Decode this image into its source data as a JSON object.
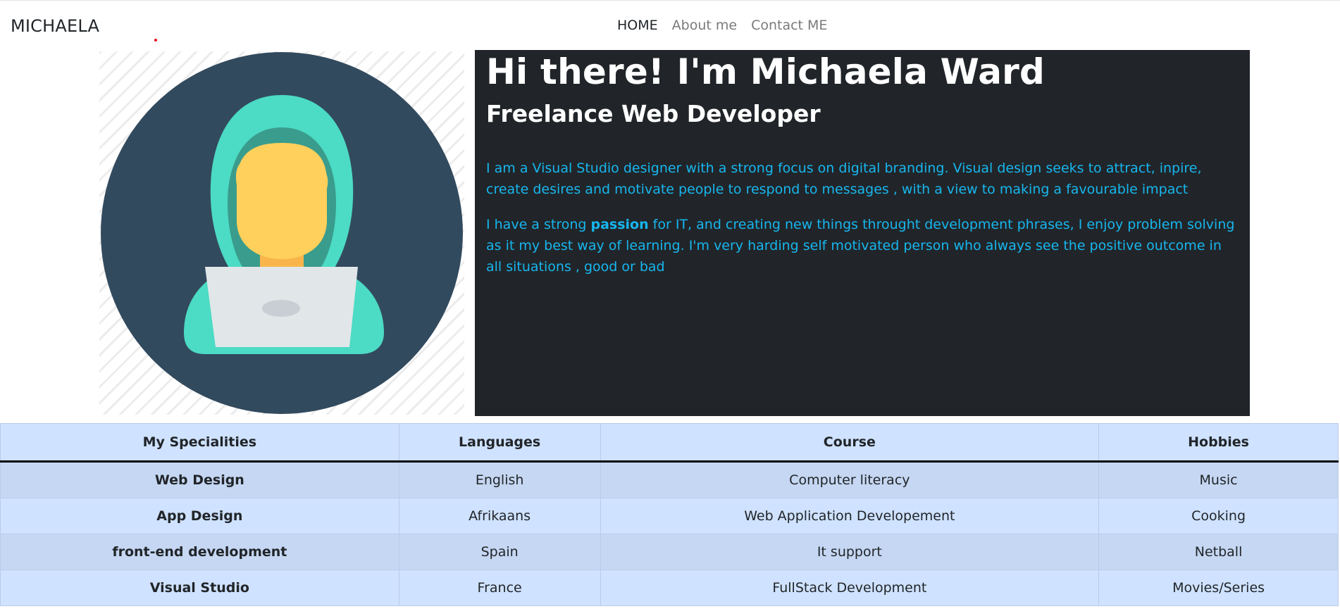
{
  "navbar": {
    "brand": "MICHAELA",
    "links": [
      {
        "label": "HOME",
        "active": true
      },
      {
        "label": "About me",
        "active": false
      },
      {
        "label": "Contact ME",
        "active": false
      }
    ]
  },
  "avatar": {
    "icon": "hooded-developer-with-laptop",
    "colors": {
      "circle": "#324a5e",
      "hood": "#4cdbc4",
      "hood_shadow": "#3a9c8c",
      "face": "#ffd05b",
      "neck": "#f9b54c",
      "laptop": "#e1e6e9",
      "laptop_logo": "#c8ced3"
    }
  },
  "intro": {
    "heading": "Hi there! I'm Michaela Ward",
    "subheading": "Freelance Web Developer",
    "paragraph1": "I am a Visual Studio designer with a strong focus on digital branding. Visual design seeks to attract, inpire, create desires and motivate people to respond to messages , with a view to making a favourable impact",
    "paragraph2_before": "I have a strong ",
    "paragraph2_bold": "passion",
    "paragraph2_after": " for IT, and creating new things throught development phrases, I enjoy problem solving as it my best way of learning. I'm very harding self motivated person who always see the positive outcome in all situations , good or bad",
    "colors": {
      "background": "#212529",
      "heading": "#ffffff",
      "text": "#17b6ee"
    }
  },
  "table": {
    "headers": [
      "My Specialities",
      "Languages",
      "Course",
      "Hobbies"
    ],
    "rows": [
      [
        "Web Design",
        "English",
        "Computer literacy",
        "Music"
      ],
      [
        "App Design",
        "Afrikaans",
        "Web Application Developement",
        "Cooking"
      ],
      [
        "front-end development",
        "Spain",
        "It support",
        "Netball"
      ],
      [
        "Visual Studio",
        "France",
        "FullStack Development",
        "Movies/Series"
      ]
    ],
    "colors": {
      "header_bg": "#cfe2ff",
      "row_odd": "#c5d7f2",
      "row_even": "#cfe2ff"
    }
  }
}
